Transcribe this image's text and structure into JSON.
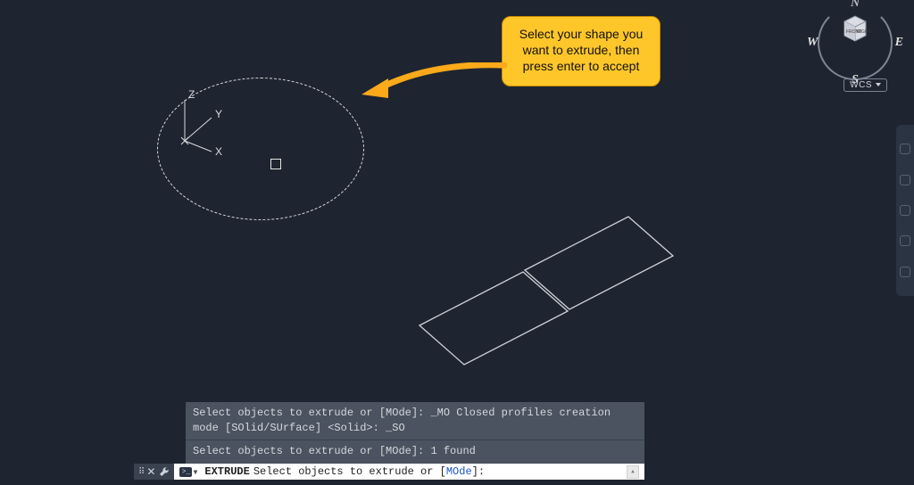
{
  "tooltip": {
    "text": "Select your shape you want to extrude, then press enter to accept"
  },
  "ucs": {
    "x_label": "X",
    "y_label": "Y",
    "z_label": "Z"
  },
  "viewcube": {
    "face_front": "FRONT",
    "face_right": "RIGHT",
    "compass_n": "N",
    "compass_s": "S",
    "compass_e": "E",
    "compass_w": "W",
    "wcs_label": "WCS"
  },
  "command_history": {
    "line1": "Select objects to extrude or [MOde]: _MO Closed profiles creation mode [SOlid/SUrface] <Solid>: _SO",
    "line2": "Select objects to extrude or [MOde]: 1 found"
  },
  "command_line": {
    "command": "EXTRUDE",
    "prompt_before": "Select objects to extrude or [",
    "option": "MOde",
    "prompt_after": "]:",
    "caret": "▾"
  }
}
